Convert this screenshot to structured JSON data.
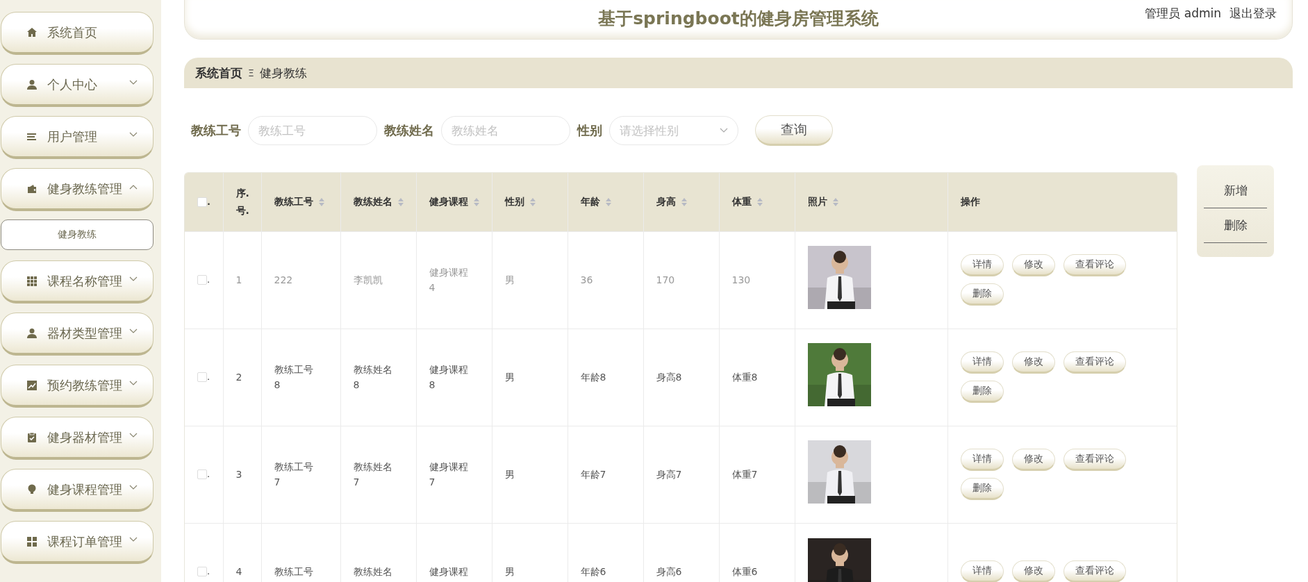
{
  "sidebar": {
    "items": [
      {
        "label": "系统首页",
        "kind": "link"
      },
      {
        "label": "个人中心",
        "kind": "menu",
        "expanded": false
      },
      {
        "label": "用户管理",
        "kind": "menu",
        "expanded": false
      },
      {
        "label": "健身教练管理",
        "kind": "menu",
        "expanded": true,
        "children": [
          {
            "label": "健身教练",
            "selected": true
          }
        ]
      },
      {
        "label": "课程名称管理",
        "kind": "menu",
        "expanded": false
      },
      {
        "label": "器材类型管理",
        "kind": "menu",
        "expanded": false
      },
      {
        "label": "预约教练管理",
        "kind": "menu",
        "expanded": false
      },
      {
        "label": "健身器材管理",
        "kind": "menu",
        "expanded": false
      },
      {
        "label": "健身课程管理",
        "kind": "menu",
        "expanded": false
      },
      {
        "label": "课程订单管理",
        "kind": "menu",
        "expanded": false
      }
    ]
  },
  "header": {
    "title": "基于springboot的健身房管理系统",
    "user": "管理员 admin",
    "logout": "退出登录"
  },
  "breadcrumb": {
    "items": [
      "系统首页",
      "健身教练"
    ],
    "separator": "Ξ"
  },
  "filters": [
    {
      "label": "教练工号",
      "placeholder": "教练工号",
      "kind": "input"
    },
    {
      "label": "教练姓名",
      "placeholder": "教练姓名",
      "kind": "input"
    },
    {
      "label": "性别",
      "placeholder": "请选择性别",
      "kind": "select"
    }
  ],
  "search_button": "查询",
  "side_actions": [
    "新增",
    "删除"
  ],
  "table": {
    "select_all": {
      "checked": false,
      "mark": "."
    },
    "columns": [
      {
        "label": "序.号.",
        "sortable": false
      },
      {
        "label": "教练工号",
        "sortable": true
      },
      {
        "label": "教练姓名",
        "sortable": true
      },
      {
        "label": "健身课程",
        "sortable": true
      },
      {
        "label": "性别",
        "sortable": true
      },
      {
        "label": "年龄",
        "sortable": true
      },
      {
        "label": "身高",
        "sortable": true
      },
      {
        "label": "体重",
        "sortable": true
      },
      {
        "label": "照片",
        "sortable": true
      },
      {
        "label": "操作",
        "sortable": false
      }
    ],
    "rows": [
      {
        "checked": false,
        "mark": ".",
        "cells": [
          "1",
          "222",
          "李凯凯",
          "健身课程4",
          "男",
          "36",
          "170",
          "130"
        ],
        "muted": true,
        "photo": {
          "kind": "picture"
        },
        "actions": [
          "详情",
          "修改",
          "查看评论",
          "删除"
        ]
      },
      {
        "checked": false,
        "mark": ".",
        "cells": [
          "2",
          "教练工号8",
          "教练姓名8",
          "健身课程8",
          "男",
          "年龄8",
          "身高8",
          "体重8"
        ],
        "muted": false,
        "photo": {
          "kind": "picture"
        },
        "actions": [
          "详情",
          "修改",
          "查看评论",
          "删除"
        ]
      },
      {
        "checked": false,
        "mark": ".",
        "cells": [
          "3",
          "教练工号7",
          "教练姓名7",
          "健身课程7",
          "男",
          "年龄7",
          "身高7",
          "体重7"
        ],
        "muted": false,
        "photo": {
          "kind": "picture"
        },
        "actions": [
          "详情",
          "修改",
          "查看评论",
          "删除"
        ]
      },
      {
        "checked": false,
        "mark": ".",
        "cells": [
          "4",
          "教练工号",
          "教练姓名",
          "健身课程",
          "男",
          "年龄6",
          "身高6",
          "体重6"
        ],
        "muted": false,
        "photo": {
          "kind": "picture"
        },
        "actions": [
          "详情",
          "修改",
          "查看评论"
        ]
      }
    ]
  }
}
